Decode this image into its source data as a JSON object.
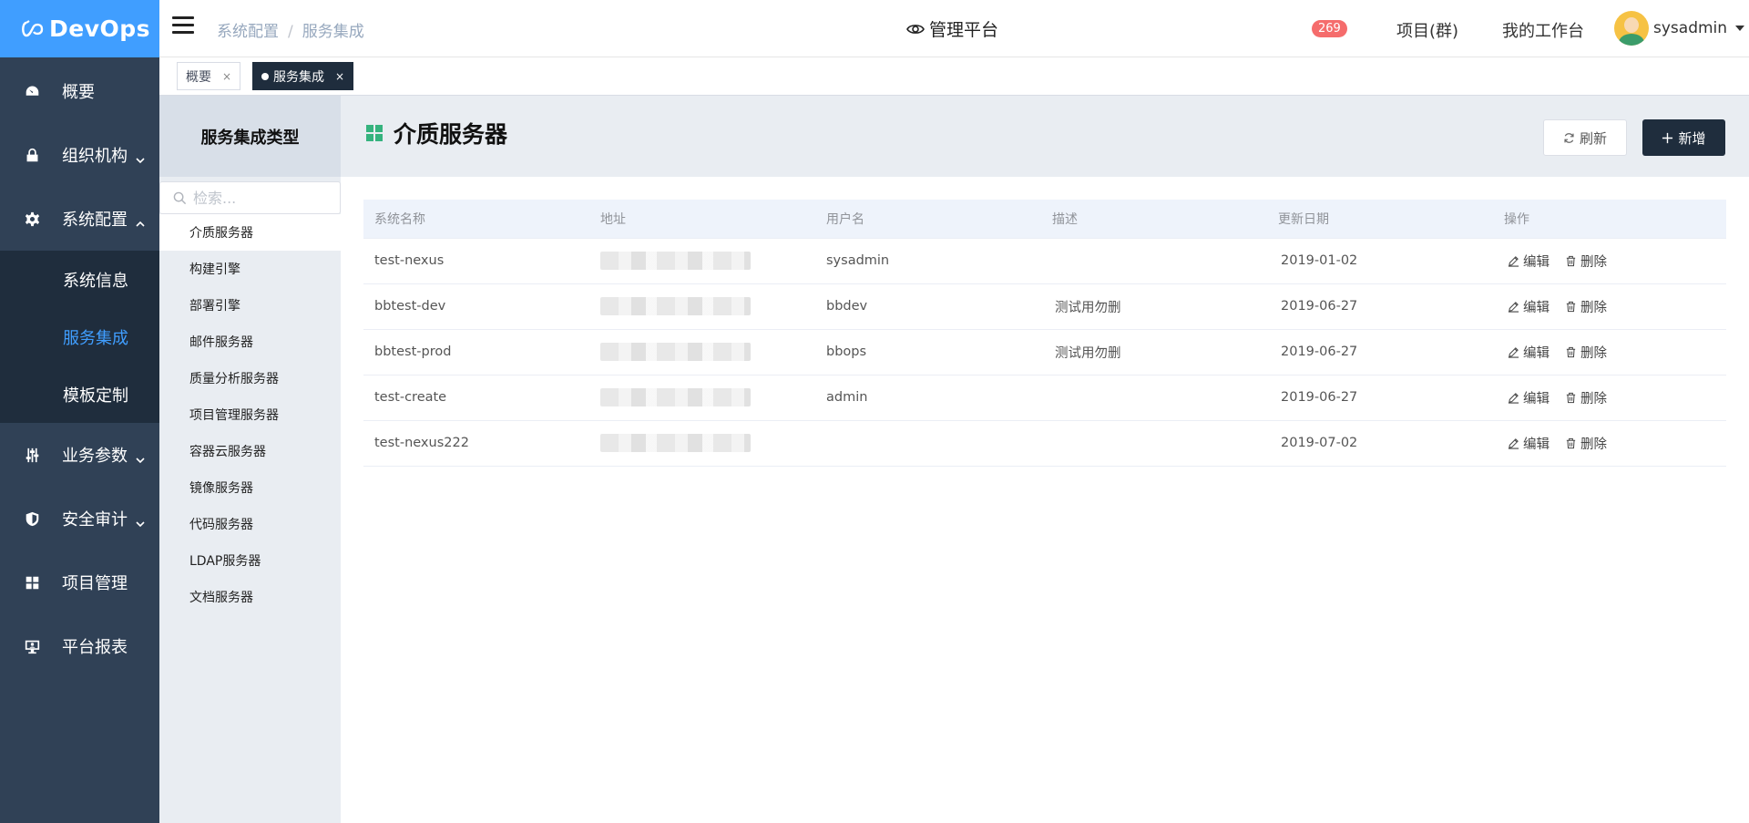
{
  "app": {
    "name": "DevOps"
  },
  "sidebar": {
    "items": [
      {
        "label": "概要",
        "icon": "dashboard-icon"
      },
      {
        "label": "组织机构",
        "icon": "lock-icon",
        "expandable": true
      },
      {
        "label": "系统配置",
        "icon": "gear-icon",
        "expanded": true,
        "children": [
          {
            "label": "系统信息"
          },
          {
            "label": "服务集成",
            "active": true
          },
          {
            "label": "模板定制"
          }
        ]
      },
      {
        "label": "业务参数",
        "icon": "sliders-icon",
        "expandable": true
      },
      {
        "label": "安全审计",
        "icon": "shield-icon",
        "expandable": true
      },
      {
        "label": "项目管理",
        "icon": "grid-icon"
      },
      {
        "label": "平台报表",
        "icon": "monitor-icon"
      }
    ]
  },
  "header": {
    "breadcrumb": [
      "系统配置",
      "服务集成"
    ],
    "breadcrumb_sep": "/",
    "platform": "管理平台",
    "badge": "269",
    "project_group": "项目(群)",
    "workspace": "我的工作台",
    "username": "sysadmin"
  },
  "tabs": [
    {
      "label": "概要",
      "close": "×"
    },
    {
      "label": "服务集成",
      "close": "×",
      "active": true
    }
  ],
  "types": {
    "title": "服务集成类型",
    "search_placeholder": "检索...",
    "items": [
      "介质服务器",
      "构建引擎",
      "部署引擎",
      "邮件服务器",
      "质量分析服务器",
      "项目管理服务器",
      "容器云服务器",
      "镜像服务器",
      "代码服务器",
      "LDAP服务器",
      "文档服务器"
    ]
  },
  "main": {
    "title": "介质服务器",
    "refresh_label": "刷新",
    "add_label": "新增",
    "columns": [
      "系统名称",
      "地址",
      "用户名",
      "描述",
      "更新日期",
      "操作"
    ],
    "edit_label": "编辑",
    "delete_label": "删除",
    "rows": [
      {
        "name": "test-nexus",
        "user": "sysadmin",
        "desc": "",
        "date": "2019-01-02"
      },
      {
        "name": "bbtest-dev",
        "user": "bbdev",
        "desc": "测试用勿删",
        "date": "2019-06-27"
      },
      {
        "name": "bbtest-prod",
        "user": "bbops",
        "desc": "测试用勿删",
        "date": "2019-06-27"
      },
      {
        "name": "test-create",
        "user": "admin",
        "desc": "",
        "date": "2019-06-27"
      },
      {
        "name": "test-nexus222",
        "user": "",
        "desc": "",
        "date": "2019-07-02"
      }
    ]
  },
  "colors": {
    "brand": "#409eff",
    "sidebar": "#304156",
    "submenu": "#1f2d3d",
    "accent": "#35b37e",
    "badge": "#f56c6c"
  }
}
